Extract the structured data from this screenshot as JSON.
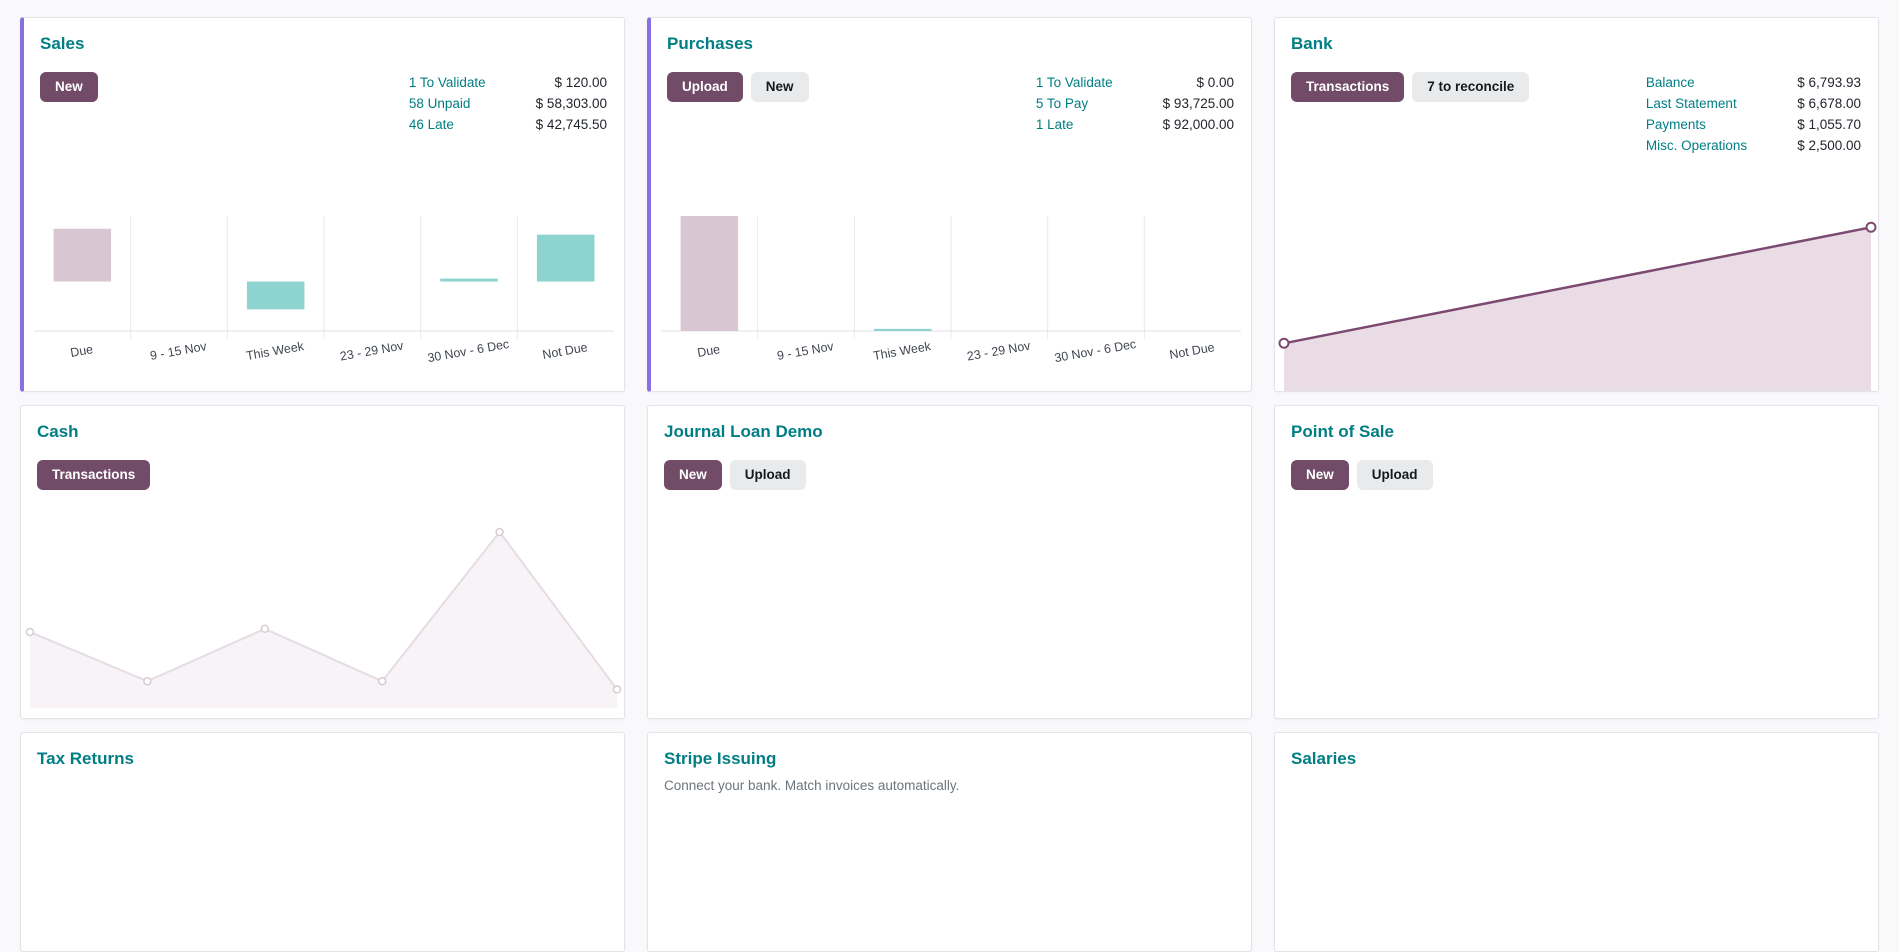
{
  "colors": {
    "teal_link": "#017e84",
    "primary_button_bg": "#714b67",
    "secondary_button_bg": "#e9eaec",
    "accent_left_border": "#8a6fe4",
    "bar_past": "#d9c6d3",
    "bar_future": "#8dd3d0",
    "bank_line": "#7c4a70",
    "bank_area_fill": "#e9dce5",
    "cash_line": "#e6dce3",
    "cash_area_fill": "#f7f3f6"
  },
  "cards": {
    "sales": {
      "title": "Sales",
      "buttons": [
        {
          "label": "New",
          "variant": "primary"
        }
      ],
      "stats": [
        {
          "label": "1 To Validate",
          "value": "$ 120.00"
        },
        {
          "label": "58 Unpaid",
          "value": "$ 58,303.00"
        },
        {
          "label": "46 Late",
          "value": "$ 42,745.50"
        }
      ]
    },
    "purchases": {
      "title": "Purchases",
      "buttons": [
        {
          "label": "Upload",
          "variant": "primary"
        },
        {
          "label": "New",
          "variant": "secondary"
        }
      ],
      "stats": [
        {
          "label": "1 To Validate",
          "value": "$ 0.00"
        },
        {
          "label": "5 To Pay",
          "value": "$ 93,725.00"
        },
        {
          "label": "1 Late",
          "value": "$ 92,000.00"
        }
      ]
    },
    "bank": {
      "title": "Bank",
      "buttons": [
        {
          "label": "Transactions",
          "variant": "primary"
        },
        {
          "label": "7 to reconcile",
          "variant": "secondary"
        }
      ],
      "stats": [
        {
          "label": "Balance",
          "value": "$ 6,793.93"
        },
        {
          "label": "Last Statement",
          "value": "$ 6,678.00"
        },
        {
          "label": "Payments",
          "value": "$ 1,055.70"
        },
        {
          "label": "Misc. Operations",
          "value": "$ 2,500.00"
        }
      ]
    },
    "cash": {
      "title": "Cash",
      "buttons": [
        {
          "label": "Transactions",
          "variant": "primary"
        }
      ]
    },
    "journal_loan": {
      "title": "Journal Loan Demo",
      "buttons": [
        {
          "label": "New",
          "variant": "primary"
        },
        {
          "label": "Upload",
          "variant": "secondary"
        }
      ]
    },
    "pos": {
      "title": "Point of Sale",
      "buttons": [
        {
          "label": "New",
          "variant": "primary"
        },
        {
          "label": "Upload",
          "variant": "secondary"
        }
      ]
    },
    "tax": {
      "title": "Tax Returns"
    },
    "stripe": {
      "title": "Stripe Issuing",
      "description": "Connect your bank. Match invoices automatically."
    },
    "salaries": {
      "title": "Salaries"
    }
  },
  "chart_data": [
    {
      "id": "sales",
      "type": "bar",
      "categories": [
        "Due",
        "9 - 15 Nov",
        "This Week",
        "23 - 29 Nov",
        "30 Nov - 6 Dec",
        "Not Due"
      ],
      "values": [
        42700,
        0,
        -22500,
        0,
        2400,
        37900
      ],
      "ylim": [
        -40000,
        53000
      ],
      "grid": true,
      "series_colors": [
        "#d9c6d3",
        "#8dd3d0"
      ]
    },
    {
      "id": "purchases",
      "type": "bar",
      "categories": [
        "Due",
        "9 - 15 Nov",
        "This Week",
        "23 - 29 Nov",
        "30 Nov - 6 Dec",
        "Not Due"
      ],
      "values": [
        92000,
        0,
        1700,
        0,
        0,
        0
      ],
      "ylim": [
        0,
        92000
      ],
      "grid": true,
      "series_colors": [
        "#d9c6d3",
        "#8dd3d0"
      ]
    },
    {
      "id": "bank",
      "type": "area",
      "x": [
        "start",
        "end"
      ],
      "values": [
        15,
        95
      ],
      "ylim": [
        0,
        100
      ]
    },
    {
      "id": "cash",
      "type": "line",
      "x": [
        1,
        2,
        3,
        4,
        5,
        6
      ],
      "values": [
        39,
        9,
        41,
        9,
        100,
        4
      ],
      "ylim": [
        0,
        100
      ]
    }
  ]
}
